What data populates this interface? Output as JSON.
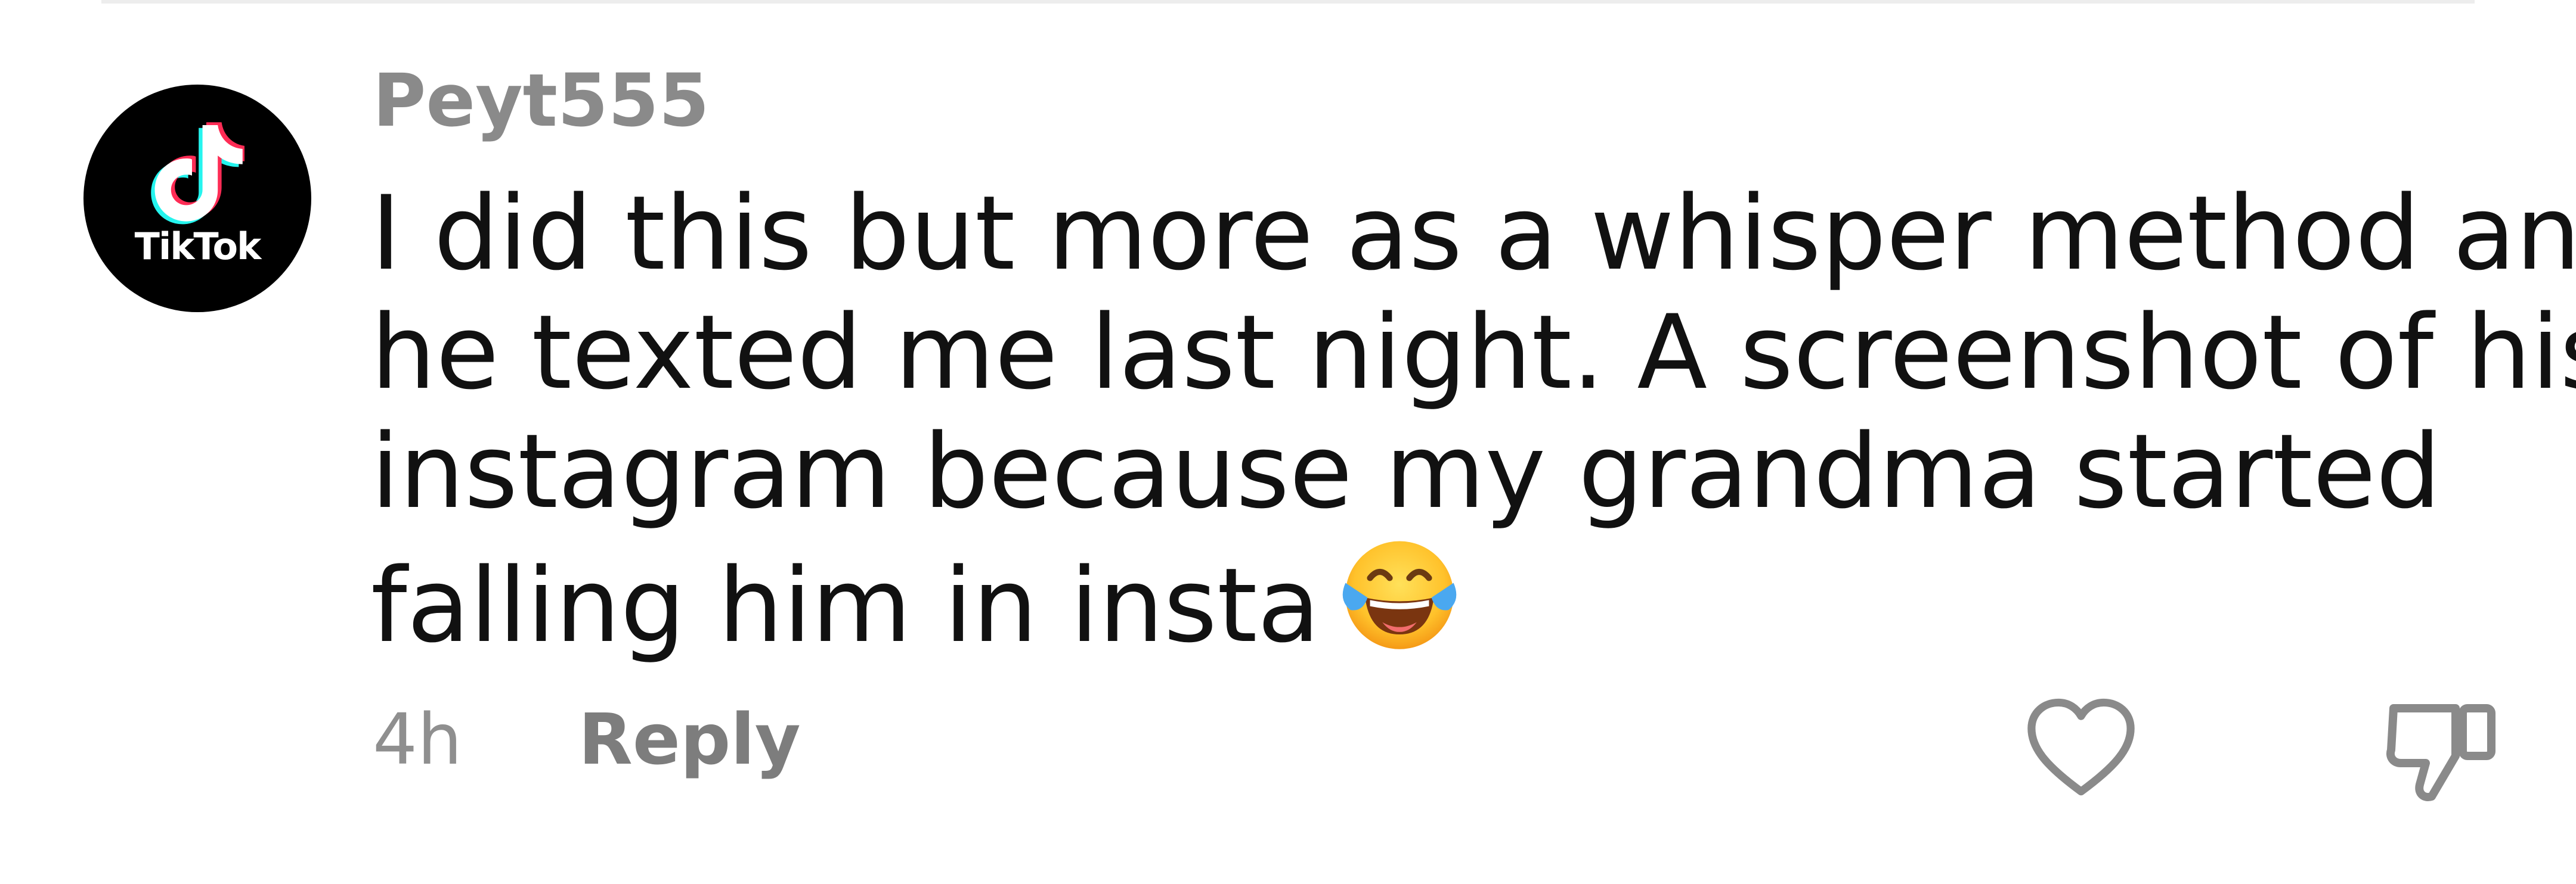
{
  "avatar": {
    "brand": "TikTok",
    "icon": "tiktok-logo-icon"
  },
  "comment": {
    "username": "Peyt555",
    "lines": [
      "I did this but more as a whisper method and",
      "he texted me last night. A screenshot of his",
      "instagram because my grandma started",
      "falling him in insta"
    ],
    "emoji": "face-with-tears-of-joy-icon",
    "time": "4h",
    "reply_label": "Reply"
  },
  "actions": {
    "like_icon": "heart-icon",
    "dislike_icon": "thumbs-down-icon"
  }
}
